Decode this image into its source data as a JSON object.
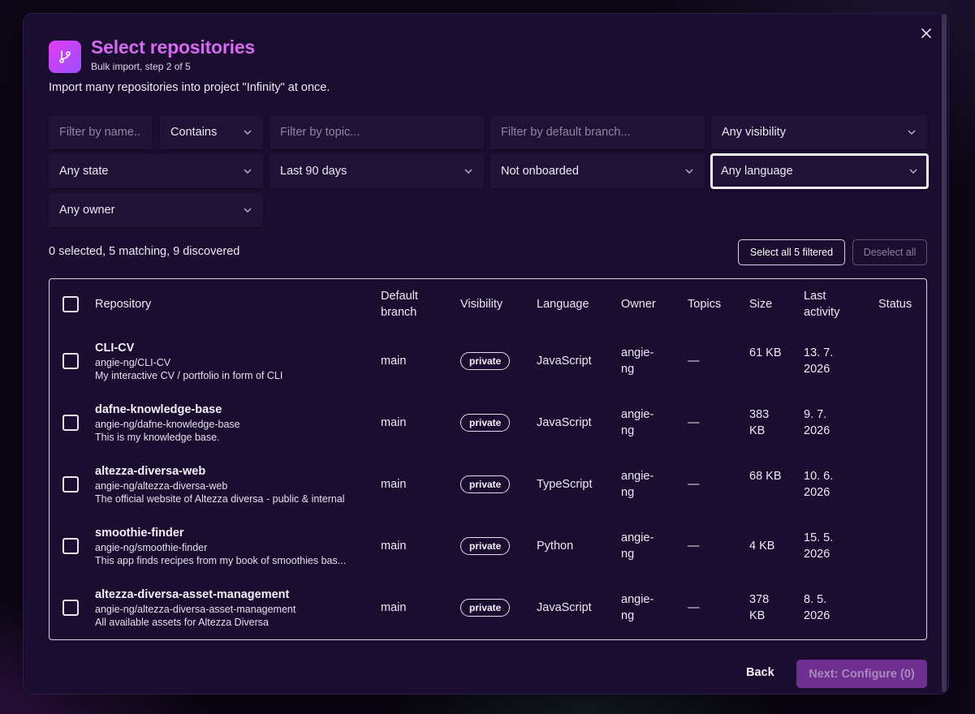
{
  "header": {
    "title": "Select repositories",
    "subtitle": "Bulk import, step 2 of 5",
    "description": "Import many repositories into project \"Infinity\" at once."
  },
  "filters": {
    "name_placeholder": "Filter by name...",
    "match_mode": "Contains",
    "topic_placeholder": "Filter by topic...",
    "branch_placeholder": "Filter by default branch...",
    "visibility": "Any visibility",
    "state": "Any state",
    "activity": "Last 90 days",
    "onboarding": "Not onboarded",
    "language": "Any language",
    "owner": "Any owner"
  },
  "summary": {
    "count_text": "0 selected, 5 matching, 9 discovered",
    "select_all_label": "Select all 5 filtered",
    "deselect_all_label": "Deselect all"
  },
  "table": {
    "headers": {
      "repository": "Repository",
      "default_branch": "Default branch",
      "visibility": "Visibility",
      "language": "Language",
      "owner": "Owner",
      "topics": "Topics",
      "size": "Size",
      "last_activity": "Last activity",
      "status": "Status"
    },
    "rows": [
      {
        "name": "CLI-CV",
        "path": "angie-ng/CLI-CV",
        "description": "My interactive CV / portfolio in form of CLI",
        "branch": "main",
        "visibility": "private",
        "language": "JavaScript",
        "owner": "angie-ng",
        "topics": "—",
        "size": "61 KB",
        "last_activity": "13. 7. 2026",
        "status": ""
      },
      {
        "name": "dafne-knowledge-base",
        "path": "angie-ng/dafne-knowledge-base",
        "description": "This is my knowledge base.",
        "branch": "main",
        "visibility": "private",
        "language": "JavaScript",
        "owner": "angie-ng",
        "topics": "—",
        "size": "383 KB",
        "last_activity": "9. 7. 2026",
        "status": ""
      },
      {
        "name": "altezza-diversa-web",
        "path": "angie-ng/altezza-diversa-web",
        "description": "The official website of Altezza diversa - public & internal",
        "branch": "main",
        "visibility": "private",
        "language": "TypeScript",
        "owner": "angie-ng",
        "topics": "—",
        "size": "68 KB",
        "last_activity": "10. 6. 2026",
        "status": ""
      },
      {
        "name": "smoothie-finder",
        "path": "angie-ng/smoothie-finder",
        "description": "This app finds recipes from my book of smoothies bas...",
        "branch": "main",
        "visibility": "private",
        "language": "Python",
        "owner": "angie-ng",
        "topics": "—",
        "size": "4 KB",
        "last_activity": "15. 5. 2026",
        "status": ""
      },
      {
        "name": "altezza-diversa-asset-management",
        "path": "angie-ng/altezza-diversa-asset-management",
        "description": "All available assets for Altezza Diversa",
        "branch": "main",
        "visibility": "private",
        "language": "JavaScript",
        "owner": "angie-ng",
        "topics": "—",
        "size": "378 KB",
        "last_activity": "8. 5. 2026",
        "status": ""
      }
    ]
  },
  "footer": {
    "back_label": "Back",
    "next_label": "Next: Configure (0)"
  },
  "colors": {
    "accent": "#d46bf0",
    "modal_bg": "#1a0d30",
    "primary_disabled": "#6e2f91"
  }
}
